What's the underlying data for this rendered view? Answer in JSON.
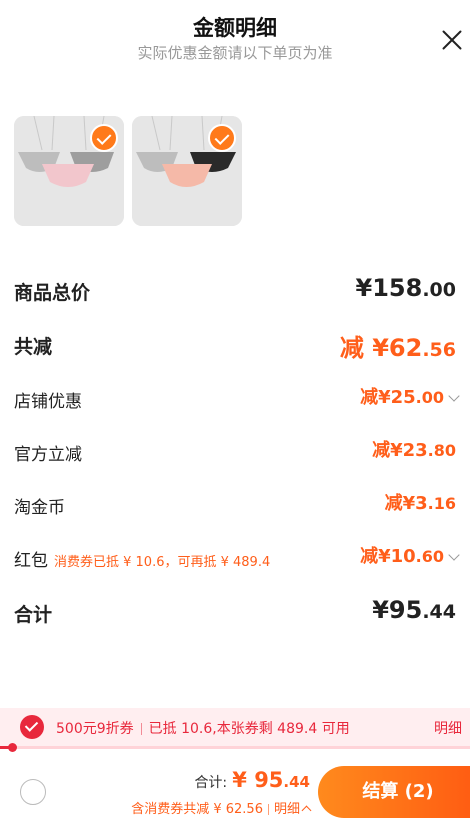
{
  "header": {
    "title": "金额明细",
    "subtitle": "实际优惠金额请以下单页为准"
  },
  "products": [
    {
      "name": "product-1",
      "selected": true
    },
    {
      "name": "product-2",
      "selected": true
    }
  ],
  "rows": {
    "total_price": {
      "label": "商品总价",
      "symbol": "¥",
      "int": "158",
      "dec": ".00"
    },
    "total_discount": {
      "label": "共减",
      "prefix": "减",
      "symbol": "¥",
      "int": "62",
      "dec": ".56"
    },
    "shop_discount": {
      "label": "店铺优惠",
      "prefix": "减",
      "symbol": "¥",
      "int": "25",
      "dec": ".00"
    },
    "official_discount": {
      "label": "官方立减",
      "prefix": "减",
      "symbol": "¥",
      "int": "23",
      "dec": ".80"
    },
    "taojinbi": {
      "label": "淘金币",
      "prefix": "减",
      "symbol": "¥",
      "int": "3",
      "dec": ".16"
    },
    "red_packet": {
      "label": "红包",
      "note": "消费券已抵 ¥ 10.6，可再抵 ¥ 489.4",
      "prefix": "减",
      "symbol": "¥",
      "int": "10",
      "dec": ".60"
    },
    "sum": {
      "label": "合计",
      "symbol": "¥",
      "int": "95",
      "dec": ".44"
    }
  },
  "coupon": {
    "name": "500元9折券",
    "status": "已抵 10.6,本张券剩 489.4 可用",
    "detail": "明细",
    "progress_fraction": 0.02
  },
  "footer": {
    "total_label": "合计:",
    "total_symbol": "¥",
    "total_int": "95",
    "total_dec": ".44",
    "saved_text": "含消费券共减 ¥ 62.56",
    "detail_label": "明细",
    "checkout_label": "结算 (2)"
  },
  "colors": {
    "accent": "#ff5e1a",
    "coupon_red": "#e8283c",
    "coupon_bg": "#ffeef0"
  }
}
